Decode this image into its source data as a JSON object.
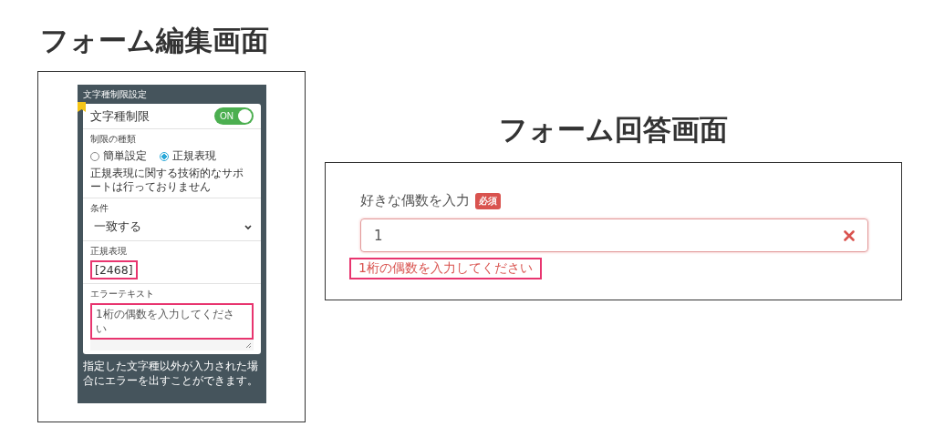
{
  "edit_screen": {
    "title": "フォーム編集画面",
    "panel_header": "文字種制限設定",
    "toggle": {
      "label": "文字種制限",
      "on": true,
      "text": "ON"
    },
    "restriction_type": {
      "label": "制限の種類",
      "options": [
        {
          "label": "簡単設定",
          "selected": false
        },
        {
          "label": "正規表現",
          "selected": true
        }
      ],
      "note": "正規表現に関する技術的なサポートは行っておりません"
    },
    "condition": {
      "label": "条件",
      "value": "一致する"
    },
    "regex": {
      "label": "正規表現",
      "value": "[2468]",
      "highlighted": true
    },
    "error_text": {
      "label": "エラーテキスト",
      "value": "1桁の偶数を入力してください",
      "highlighted": true
    },
    "footer_note": "指定した文字種以外が入力された場合にエラーを出すことができます。"
  },
  "answer_screen": {
    "title": "フォーム回答画面",
    "question": "好きな偶数を入力",
    "required_badge": "必須",
    "input_value": "1",
    "error_message": "1桁の偶数を入力してください",
    "error_highlighted": true
  }
}
